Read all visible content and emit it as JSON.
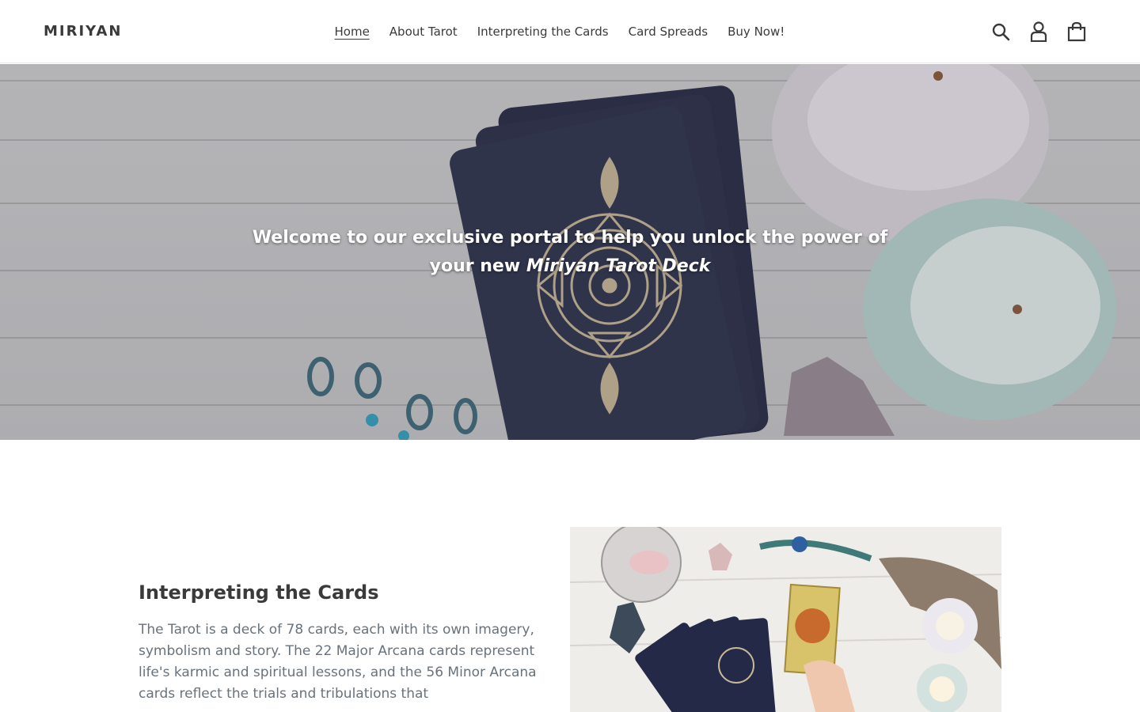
{
  "header": {
    "logo": "MIRIYAN",
    "nav": [
      {
        "label": "Home",
        "active": true
      },
      {
        "label": "About Tarot",
        "active": false
      },
      {
        "label": "Interpreting the Cards",
        "active": false
      },
      {
        "label": "Card Spreads",
        "active": false
      },
      {
        "label": "Buy Now!",
        "active": false
      }
    ],
    "icons": [
      "search-icon",
      "account-icon",
      "cart-icon"
    ]
  },
  "hero": {
    "line1": "Welcome to our exclusive portal to help you unlock the power of",
    "line2_prefix": "your new ",
    "line2_emphasis": "Miriyan Tarot Deck"
  },
  "feature": {
    "title": "Interpreting the Cards",
    "body": "The Tarot is a deck of 78 cards, each with its own imagery, symbolism and story. The 22 Major Arcana cards represent life's karmic and spiritual lessons, and the 56 Minor Arcana cards reflect the trials and tribulations that"
  },
  "colors": {
    "text": "#3a3a3a",
    "body_text": "#69727b",
    "deck_navy": "#2c3049",
    "card_gold": "#c9b896"
  }
}
